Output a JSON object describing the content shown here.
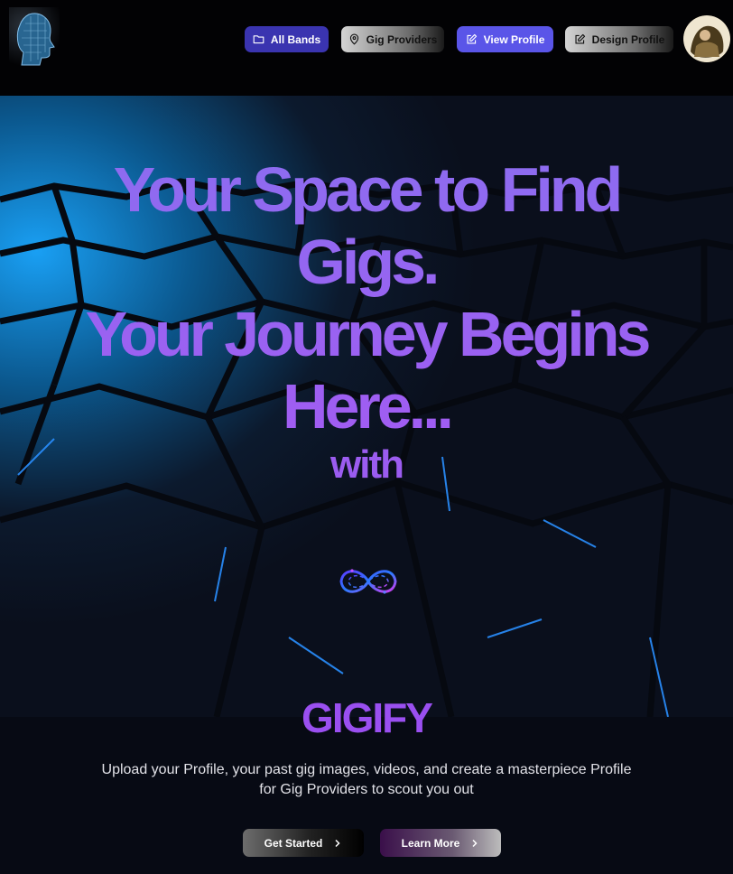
{
  "nav": {
    "items": [
      {
        "label": "All Bands",
        "icon": "folder-icon"
      },
      {
        "label": "Gig Providers",
        "icon": "map-pin-icon"
      },
      {
        "label": "View Profile",
        "icon": "edit-icon"
      },
      {
        "label": "Design Profile",
        "icon": "edit-icon"
      }
    ]
  },
  "hero": {
    "headline_lines": [
      "Your Space to Find",
      "Gigs.",
      "Your Journey Begins",
      "Here..."
    ],
    "with_label": "with",
    "brand": "GIGIFY",
    "description": "Upload your Profile, your past gig images, videos, and create a masterpiece Profile for Gig Providers to scout you out",
    "primary_cta": "Get Started",
    "secondary_cta": "Learn More"
  },
  "colors": {
    "accent_purple": "#9a5cf5",
    "nav_active": "#3a34b0",
    "nav_view": "#5a55e8",
    "hex_glow": "#1ea2ff"
  }
}
